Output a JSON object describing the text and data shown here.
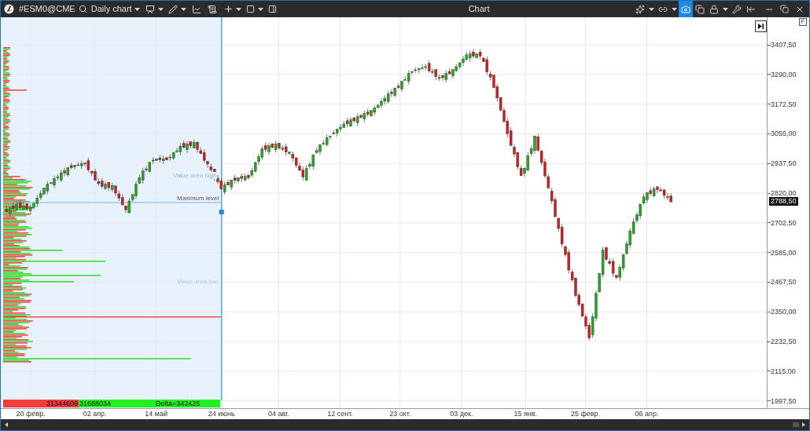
{
  "window": {
    "title": "Chart"
  },
  "toolbar": {
    "symbol": "#ESM0@CME",
    "timeframe": "Daily chart"
  },
  "right_tools": [
    {
      "kind": "sparkle",
      "selected": false
    },
    {
      "kind": "link",
      "selected": false
    },
    {
      "kind": "camera",
      "selected": true
    },
    {
      "kind": "copy",
      "selected": false
    },
    {
      "kind": "lock",
      "selected": false
    },
    {
      "kind": "tools",
      "selected": false
    },
    {
      "kind": "pin",
      "selected": false
    }
  ],
  "profile": {
    "labels": [
      "Value area high",
      "Maximum level",
      "Value area low"
    ],
    "sell_volume": "31344609",
    "buy_volume": "31688034",
    "delta": "Delta=343425"
  },
  "axis_button": "F",
  "price_tag": "2788,50",
  "price_axis": [
    "3407,50",
    "3290,00",
    "3172,50",
    "3055,00",
    "2937,50",
    "2820,00",
    "2702,50",
    "2585,00",
    "2467,50",
    "2350,00",
    "2232,50",
    "2115,00",
    "1997,50"
  ],
  "date_axis": [
    "20 февр.",
    "02 апр.",
    "14 май",
    "24 июнь",
    "04 авг.",
    "12 сент.",
    "23 окт.",
    "03 дек.",
    "15 янв.",
    "25 февр.",
    "06 апр."
  ]
}
